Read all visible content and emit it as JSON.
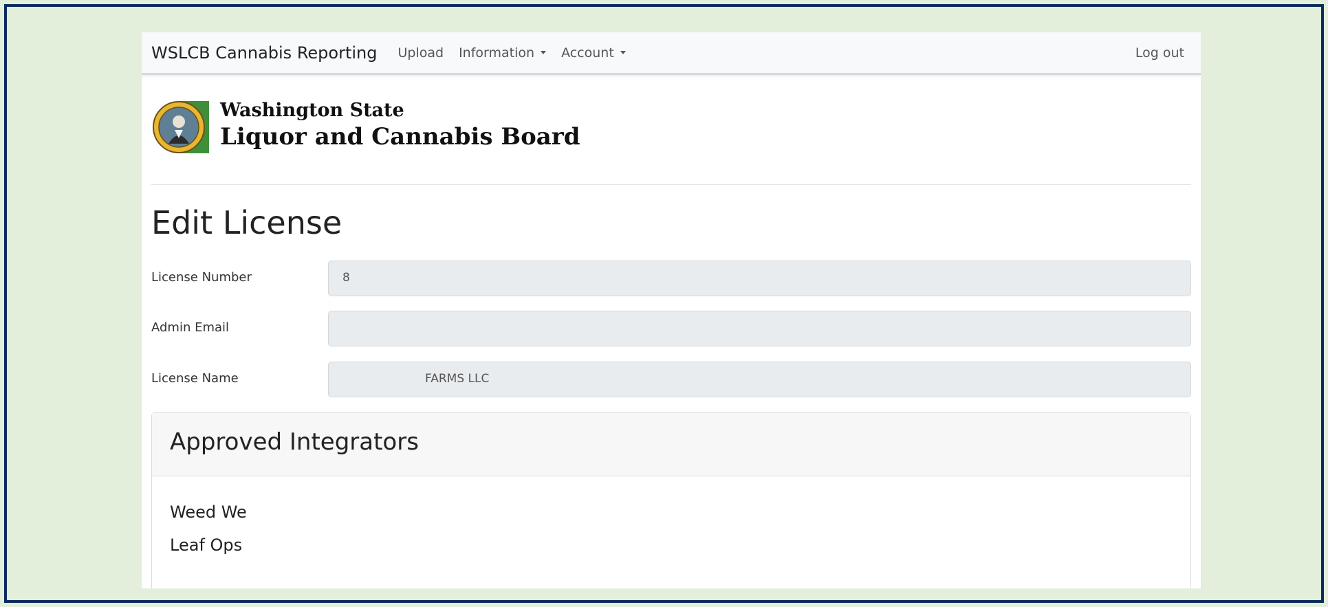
{
  "navbar": {
    "brand": "WSLCB Cannabis Reporting",
    "links": [
      {
        "label": "Upload"
      },
      {
        "label": "Information"
      },
      {
        "label": "Account"
      }
    ],
    "logout_label": "Log out"
  },
  "header": {
    "agency_line1": "Washington State",
    "agency_line2": "Liquor and Cannabis Board"
  },
  "page": {
    "title": "Edit License"
  },
  "form": {
    "license_number": {
      "label": "License Number",
      "value": "8"
    },
    "admin_email": {
      "label": "Admin Email",
      "value": ""
    },
    "license_name": {
      "label": "License Name",
      "value": "FARMS LLC"
    }
  },
  "integrators": {
    "title": "Approved Integrators",
    "items": [
      "Weed We",
      "Leaf Ops"
    ]
  },
  "colors": {
    "frame_border": "#0e2a5e",
    "background": "#e3eedb",
    "navbar_bg": "#f8f9fa",
    "input_bg": "#e9ecef",
    "seal_green": "#3f8f3a"
  }
}
